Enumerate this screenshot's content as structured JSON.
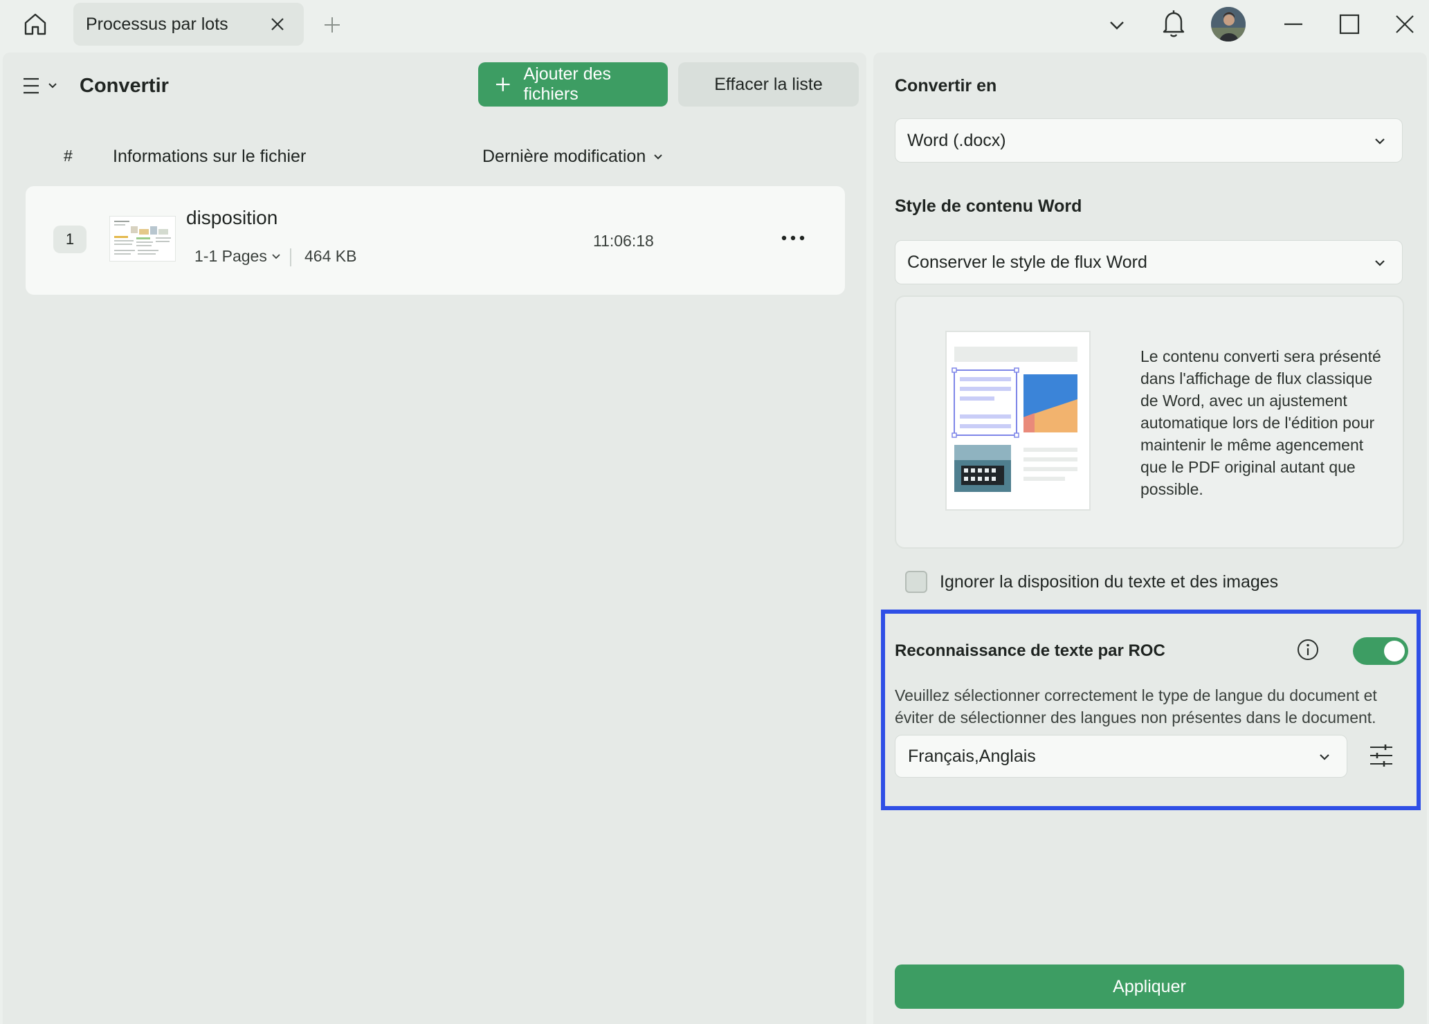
{
  "titlebar": {
    "tab_label": "Processus par lots",
    "icons": [
      "home-icon",
      "close-icon",
      "plus-icon",
      "chevron-down-icon",
      "bell-icon",
      "avatar",
      "minimize-icon",
      "maximize-icon",
      "close-window-icon"
    ]
  },
  "left": {
    "title": "Convertir",
    "add_files_label": "Ajouter des fichiers",
    "clear_list_label": "Effacer la liste",
    "columns": {
      "hash": "#",
      "info": "Informations sur le fichier",
      "modified": "Dernière modification"
    },
    "files": [
      {
        "index": "1",
        "name": "disposition",
        "pages": "1-1 Pages",
        "size": "464 KB",
        "time": "11:06:18"
      }
    ]
  },
  "right": {
    "convert_to_label": "Convertir en",
    "convert_to_value": "Word (.docx)",
    "content_style_label": "Style de contenu Word",
    "content_style_value": "Conserver le style de flux Word",
    "preview_description": "Le contenu converti sera présenté dans l'affichage de flux classique de Word, avec un ajustement automatique lors de l'édition pour maintenir le même agencement que le PDF original autant que possible.",
    "ignore_layout_label": "Ignorer la disposition du texte et des images",
    "ignore_layout_checked": false,
    "ocr": {
      "title": "Reconnaissance de texte par ROC",
      "enabled": true,
      "description": "Veuillez sélectionner correctement le type de langue du document et éviter de sélectionner des langues non présentes dans le document.",
      "languages": "Français,Anglais"
    },
    "apply_label": "Appliquer"
  },
  "colors": {
    "accent_green": "#3d9d63",
    "highlight_blue": "#2f4fe6",
    "background": "#ecf0ed"
  }
}
